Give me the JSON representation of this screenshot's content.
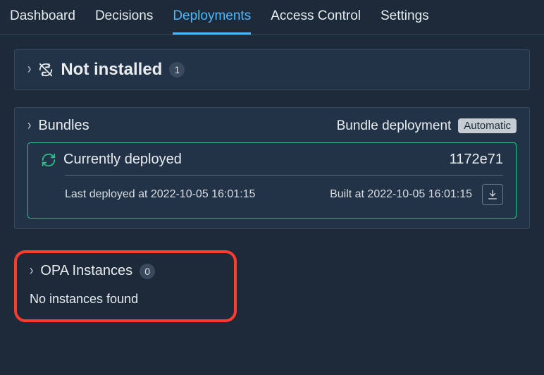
{
  "tabs": {
    "dashboard": "Dashboard",
    "decisions": "Decisions",
    "deployments": "Deployments",
    "access_control": "Access Control",
    "settings": "Settings"
  },
  "not_installed": {
    "title": "Not installed",
    "count": "1"
  },
  "bundles": {
    "title": "Bundles",
    "deploy_label": "Bundle deployment",
    "deploy_mode": "Automatic",
    "current": {
      "label": "Currently deployed",
      "hash": "1172e71",
      "last_deployed": "Last deployed at 2022-10-05 16:01:15",
      "built_at": "Built at 2022-10-05 16:01:15"
    }
  },
  "opa": {
    "title": "OPA Instances",
    "count": "0",
    "empty": "No instances found"
  }
}
